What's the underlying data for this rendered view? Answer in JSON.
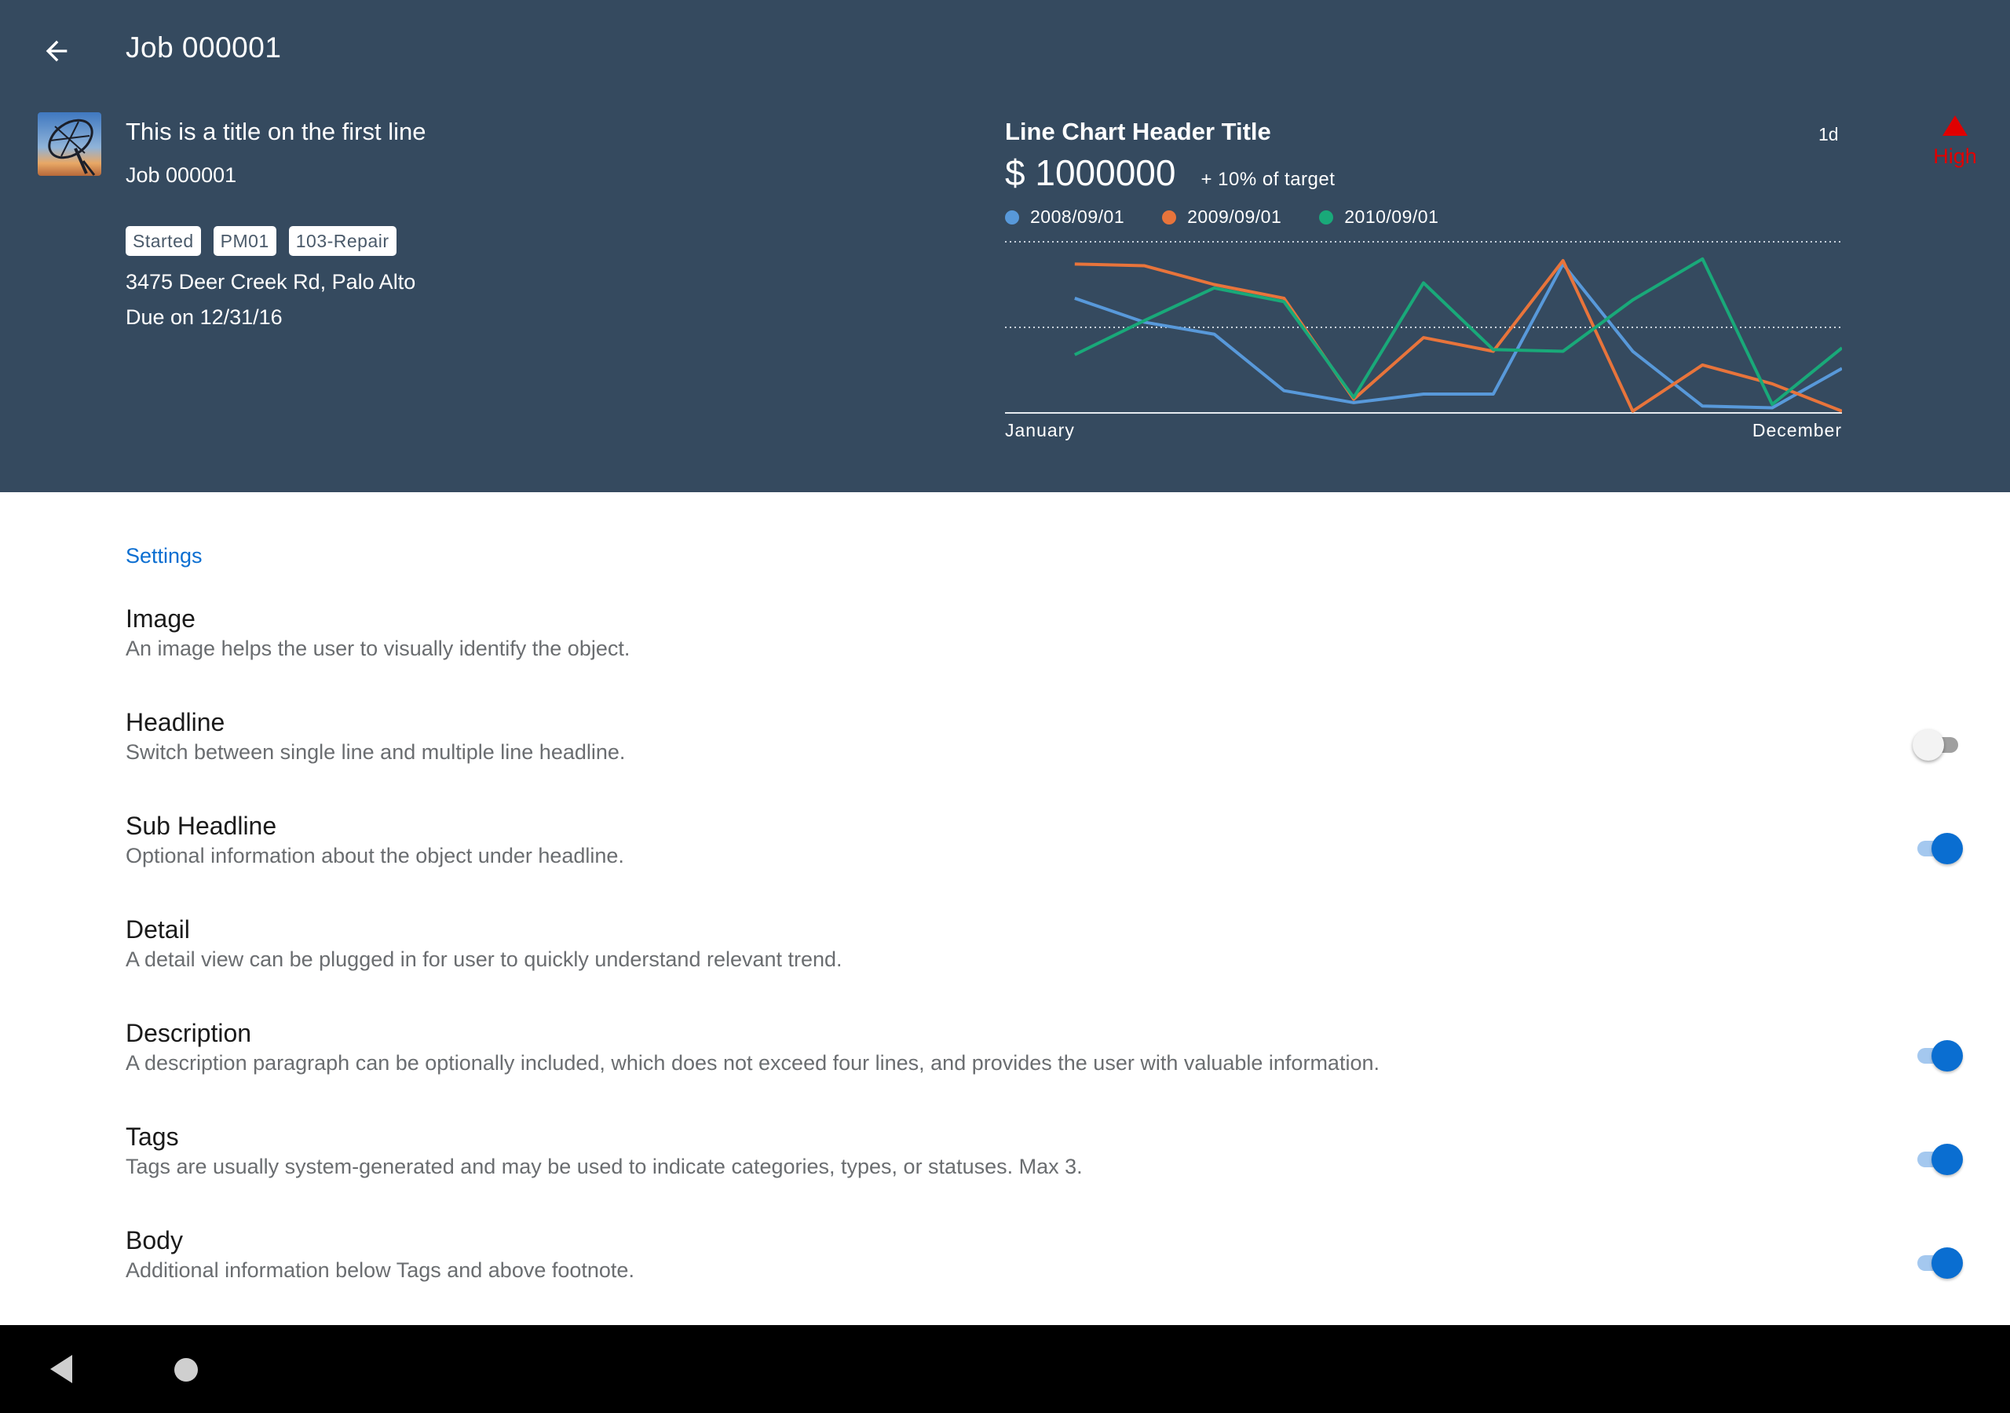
{
  "header": {
    "page_title": "Job 000001",
    "object": {
      "title": "This is a title on the first line",
      "subtitle": "Job 000001",
      "tags": [
        "Started",
        "PM01",
        "103-Repair"
      ],
      "address": "3475 Deer Creek Rd, Palo Alto",
      "due": "Due on 12/31/16"
    },
    "priority": {
      "label": "High",
      "icon": "warning-triangle-icon",
      "color": "#e00000"
    }
  },
  "chart_data": {
    "type": "line",
    "title": "Line Chart Header Title",
    "period": "1d",
    "kpi_value": "$ 1000000",
    "kpi_target": "+ 10% of target",
    "x_start_label": "January",
    "x_end_label": "December",
    "x": [
      1,
      2,
      3,
      4,
      5,
      6,
      7,
      8,
      9,
      10,
      11,
      12,
      13
    ],
    "ylim": [
      0,
      100
    ],
    "grid": true,
    "series": [
      {
        "name": "2008/09/01",
        "color": "#5899da",
        "values": [
          67,
          53,
          46,
          13,
          6,
          11,
          11,
          87,
          36,
          4,
          3,
          26
        ]
      },
      {
        "name": "2009/09/01",
        "color": "#e8743b",
        "values": [
          87,
          86,
          75,
          67,
          8,
          44,
          36,
          89,
          1,
          28,
          17,
          1
        ]
      },
      {
        "name": "2010/09/01",
        "color": "#19a979",
        "values": [
          34,
          54,
          73,
          65,
          9,
          76,
          37,
          36,
          66,
          90,
          5,
          38
        ]
      }
    ]
  },
  "settings": {
    "heading": "Settings",
    "items": [
      {
        "title": "Image",
        "description": "An image helps the user to visually identify the object.",
        "toggle": null
      },
      {
        "title": "Headline",
        "description": "Switch between single line and multiple line headline.",
        "toggle": false
      },
      {
        "title": "Sub Headline",
        "description": "Optional information about the object under headline.",
        "toggle": true
      },
      {
        "title": "Detail",
        "description": "A detail view can be plugged in for user to quickly understand relevant trend.",
        "toggle": null
      },
      {
        "title": "Description",
        "description": "A description paragraph can be optionally included, which does not exceed four lines, and provides the user with valuable information.",
        "toggle": true
      },
      {
        "title": "Tags",
        "description": "Tags are usually system-generated and may be used to indicate categories, types, or statuses. Max 3.",
        "toggle": true
      },
      {
        "title": "Body",
        "description": "Additional information below Tags and above footnote.",
        "toggle": true
      }
    ]
  },
  "navbar": {
    "back_icon": "nav-back-triangle-icon",
    "home_icon": "nav-home-circle-icon"
  }
}
